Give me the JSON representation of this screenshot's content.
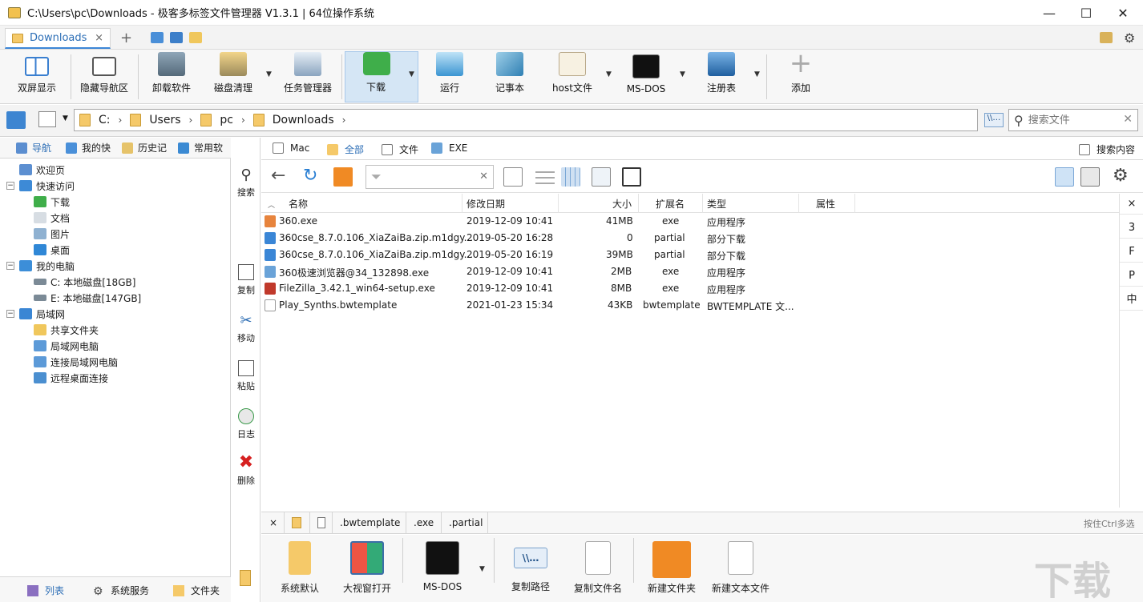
{
  "window": {
    "title": "C:\\Users\\pc\\Downloads - 极客多标签文件管理器 V1.3.1  |  64位操作系统",
    "minimize": "—",
    "maximize": "☐",
    "close": "✕"
  },
  "tabs": [
    {
      "label": "Downloads",
      "close": "×"
    }
  ],
  "tab_add": "+",
  "toolbar": {
    "items": [
      {
        "label": "双屏显示",
        "icon": "dual-screen-icon"
      },
      {
        "label": "隐藏导航区",
        "icon": "hide-nav-icon"
      },
      {
        "label": "卸载软件",
        "icon": "uninstall-icon"
      },
      {
        "label": "磁盘清理",
        "icon": "disk-cleanup-icon"
      },
      {
        "label": "任务管理器",
        "icon": "task-manager-icon"
      },
      {
        "label": "下载",
        "icon": "download-icon"
      },
      {
        "label": "运行",
        "icon": "run-icon"
      },
      {
        "label": "记事本",
        "icon": "notepad-icon"
      },
      {
        "label": "host文件",
        "icon": "host-file-icon"
      },
      {
        "label": "MS-DOS",
        "icon": "msdos-icon"
      },
      {
        "label": "注册表",
        "icon": "registry-icon"
      },
      {
        "label": "添加",
        "icon": "add-icon"
      }
    ]
  },
  "address": {
    "crumbs": [
      "C:",
      "Users",
      "pc",
      "Downloads"
    ],
    "search_placeholder": "搜索文件"
  },
  "left_tabs": [
    "导航",
    "我的快",
    "历史记",
    "常用软"
  ],
  "tree": [
    {
      "label": "欢迎页",
      "level": 0,
      "expander": ""
    },
    {
      "label": "快速访问",
      "level": 0,
      "expander": "−"
    },
    {
      "label": "下载",
      "level": 1,
      "expander": ""
    },
    {
      "label": "文档",
      "level": 1,
      "expander": ""
    },
    {
      "label": "图片",
      "level": 1,
      "expander": ""
    },
    {
      "label": "桌面",
      "level": 1,
      "expander": ""
    },
    {
      "label": "我的电脑",
      "level": 0,
      "expander": "−"
    },
    {
      "label": "C: 本地磁盘[18GB]",
      "level": 1,
      "expander": ""
    },
    {
      "label": "E: 本地磁盘[147GB]",
      "level": 1,
      "expander": ""
    },
    {
      "label": "局域网",
      "level": 0,
      "expander": "−"
    },
    {
      "label": "共享文件夹",
      "level": 1,
      "expander": ""
    },
    {
      "label": "局域网电脑",
      "level": 1,
      "expander": ""
    },
    {
      "label": "连接局域网电脑",
      "level": 1,
      "expander": ""
    },
    {
      "label": "远程桌面连接",
      "level": 1,
      "expander": ""
    }
  ],
  "left_bottom_tabs": [
    "列表",
    "系统服务",
    "文件夹"
  ],
  "side_actions": [
    "搜索",
    "复制",
    "移动",
    "粘贴",
    "日志",
    "删除"
  ],
  "file_tabs": [
    "Mac",
    "全部",
    "文件",
    "EXE"
  ],
  "search_content": "搜索内容",
  "columns": [
    "名称",
    "修改日期",
    "大小",
    "扩展名",
    "类型",
    "属性"
  ],
  "files": [
    {
      "name": "360.exe",
      "date": "2019-12-09 10:41",
      "size": "41MB",
      "ext": "exe",
      "type": "应用程序",
      "color": "#e7843d"
    },
    {
      "name": "360cse_8.7.0.106_XiaZaiBa.zip.m1dgy...",
      "date": "2019-05-20 16:28",
      "size": "0",
      "ext": "partial",
      "type": "部分下载",
      "color": "#3a86d6"
    },
    {
      "name": "360cse_8.7.0.106_XiaZaiBa.zip.m1dgy...",
      "date": "2019-05-20 16:19",
      "size": "39MB",
      "ext": "partial",
      "type": "部分下载",
      "color": "#3a86d6"
    },
    {
      "name": "360极速浏览器@34_132898.exe",
      "date": "2019-12-09 10:41",
      "size": "2MB",
      "ext": "exe",
      "type": "应用程序",
      "color": "#6aa3d8"
    },
    {
      "name": "FileZilla_3.42.1_win64-setup.exe",
      "date": "2019-12-09 10:41",
      "size": "8MB",
      "ext": "exe",
      "type": "应用程序",
      "color": "#c0392b"
    },
    {
      "name": "Play_Synths.bwtemplate",
      "date": "2021-01-23 15:34",
      "size": "43KB",
      "ext": "bwtemplate",
      "type": "BWTEMPLATE 文...",
      "color": "#ffffff"
    }
  ],
  "right_index": [
    "×",
    "3",
    "F",
    "P",
    "中"
  ],
  "ext_filters": [
    "×",
    ".bwtemplate",
    ".exe",
    ".partial"
  ],
  "multi_select_hint": "按住Ctrl多选",
  "bottom_tools": [
    {
      "label": "系统默认",
      "icon": "system-default-icon"
    },
    {
      "label": "大视窗打开",
      "icon": "large-window-icon"
    },
    {
      "label": "MS-DOS",
      "icon": "msdos-icon"
    },
    {
      "label": "复制路径",
      "icon": "copy-path-icon"
    },
    {
      "label": "复制文件名",
      "icon": "copy-filename-icon"
    },
    {
      "label": "新建文件夹",
      "icon": "new-folder-icon"
    },
    {
      "label": "新建文本文件",
      "icon": "new-text-file-icon"
    }
  ],
  "watermark": "下载吧",
  "colors": {
    "accent": "#2c6eb6",
    "active_toolbar": "#d5e6f5",
    "folder": "#f5c969"
  }
}
